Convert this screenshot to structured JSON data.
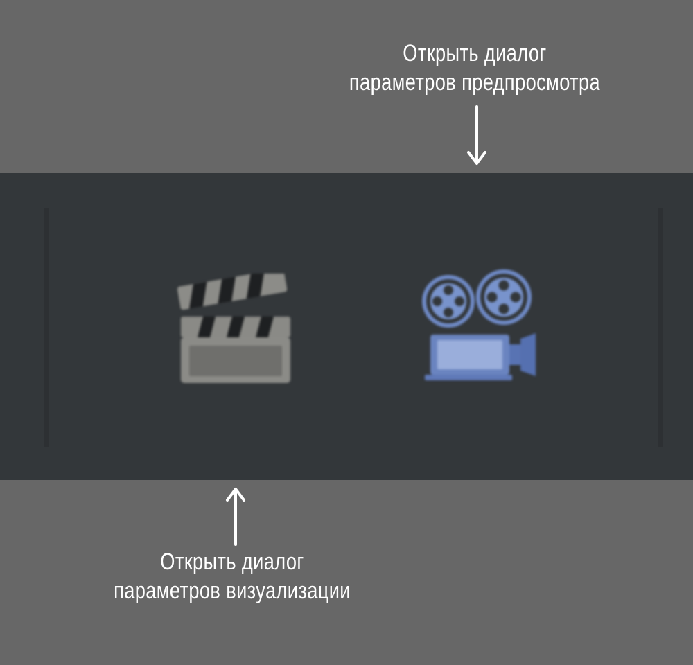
{
  "annotations": {
    "preview_dialog": {
      "line1": "Открыть диалог",
      "line2": "параметров предпросмотра"
    },
    "render_dialog": {
      "line1": "Открыть диалог",
      "line2": "параметров визуализации"
    }
  },
  "toolbar": {
    "buttons": [
      {
        "icon": "clapperboard-icon",
        "action": "render-settings"
      },
      {
        "icon": "movie-camera-icon",
        "action": "preview-settings"
      }
    ]
  },
  "colors": {
    "page_background": "#676767",
    "toolbar_background": "#33373a",
    "annotation_text": "#ffffff",
    "clapperboard": "#8a8a86",
    "camera": "#6b86c2"
  }
}
